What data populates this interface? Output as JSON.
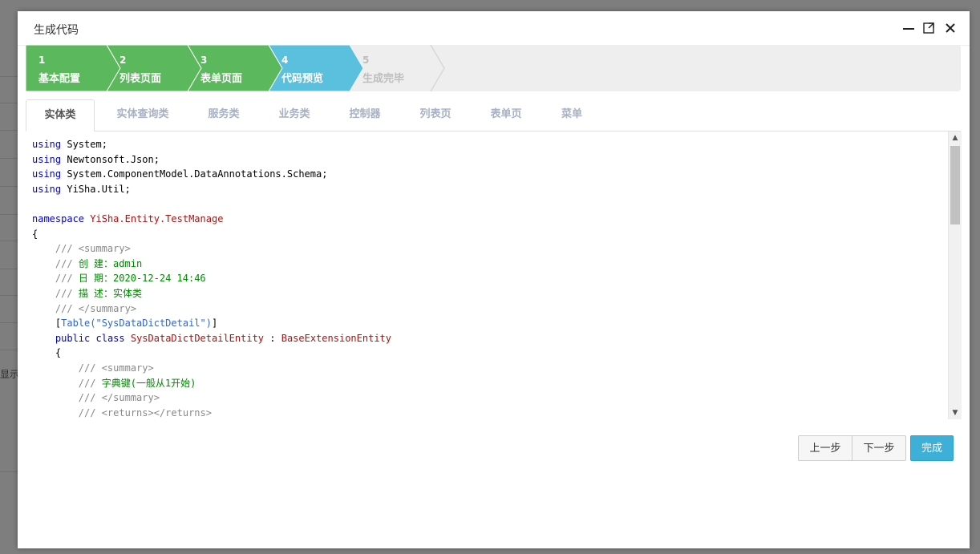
{
  "background": {
    "partial_text": "显示"
  },
  "dialog": {
    "title": "生成代码",
    "controls": [
      "minimize-icon",
      "maximize-icon",
      "close-icon"
    ]
  },
  "wizard": {
    "colors": {
      "done": "#5cb85c",
      "current": "#5bc0de",
      "disabled": "#eeeeee"
    },
    "steps": [
      {
        "number": "1",
        "label": "基本配置",
        "state": "done"
      },
      {
        "number": "2",
        "label": "列表页面",
        "state": "done"
      },
      {
        "number": "3",
        "label": "表单页面",
        "state": "done"
      },
      {
        "number": "4",
        "label": "代码预览",
        "state": "current"
      },
      {
        "number": "5",
        "label": "生成完毕",
        "state": "disabled"
      }
    ]
  },
  "tabs": [
    {
      "label": "实体类",
      "active": true
    },
    {
      "label": "实体查询类",
      "active": false
    },
    {
      "label": "服务类",
      "active": false
    },
    {
      "label": "业务类",
      "active": false
    },
    {
      "label": "控制器",
      "active": false
    },
    {
      "label": "列表页",
      "active": false
    },
    {
      "label": "表单页",
      "active": false
    },
    {
      "label": "菜单",
      "active": false
    }
  ],
  "code": {
    "lines": [
      "using System;",
      "using Newtonsoft.Json;",
      "using System.ComponentModel.DataAnnotations.Schema;",
      "using YiSha.Util;",
      "",
      "namespace YiSha.Entity.TestManage",
      "{",
      "    /// <summary>",
      "    /// 创 建：admin",
      "    /// 日 期：2020-12-24 14:46",
      "    /// 描 述：实体类",
      "    /// </summary>",
      "    [Table(\"SysDataDictDetail\")]",
      "    public class SysDataDictDetailEntity : BaseExtensionEntity",
      "    {",
      "        /// <summary>",
      "        /// 字典键(一般从1开始)",
      "        /// </summary>",
      "        /// <returns></returns>"
    ]
  },
  "footer": {
    "prev_label": "上一步",
    "next_label": "下一步",
    "finish_label": "完成"
  }
}
